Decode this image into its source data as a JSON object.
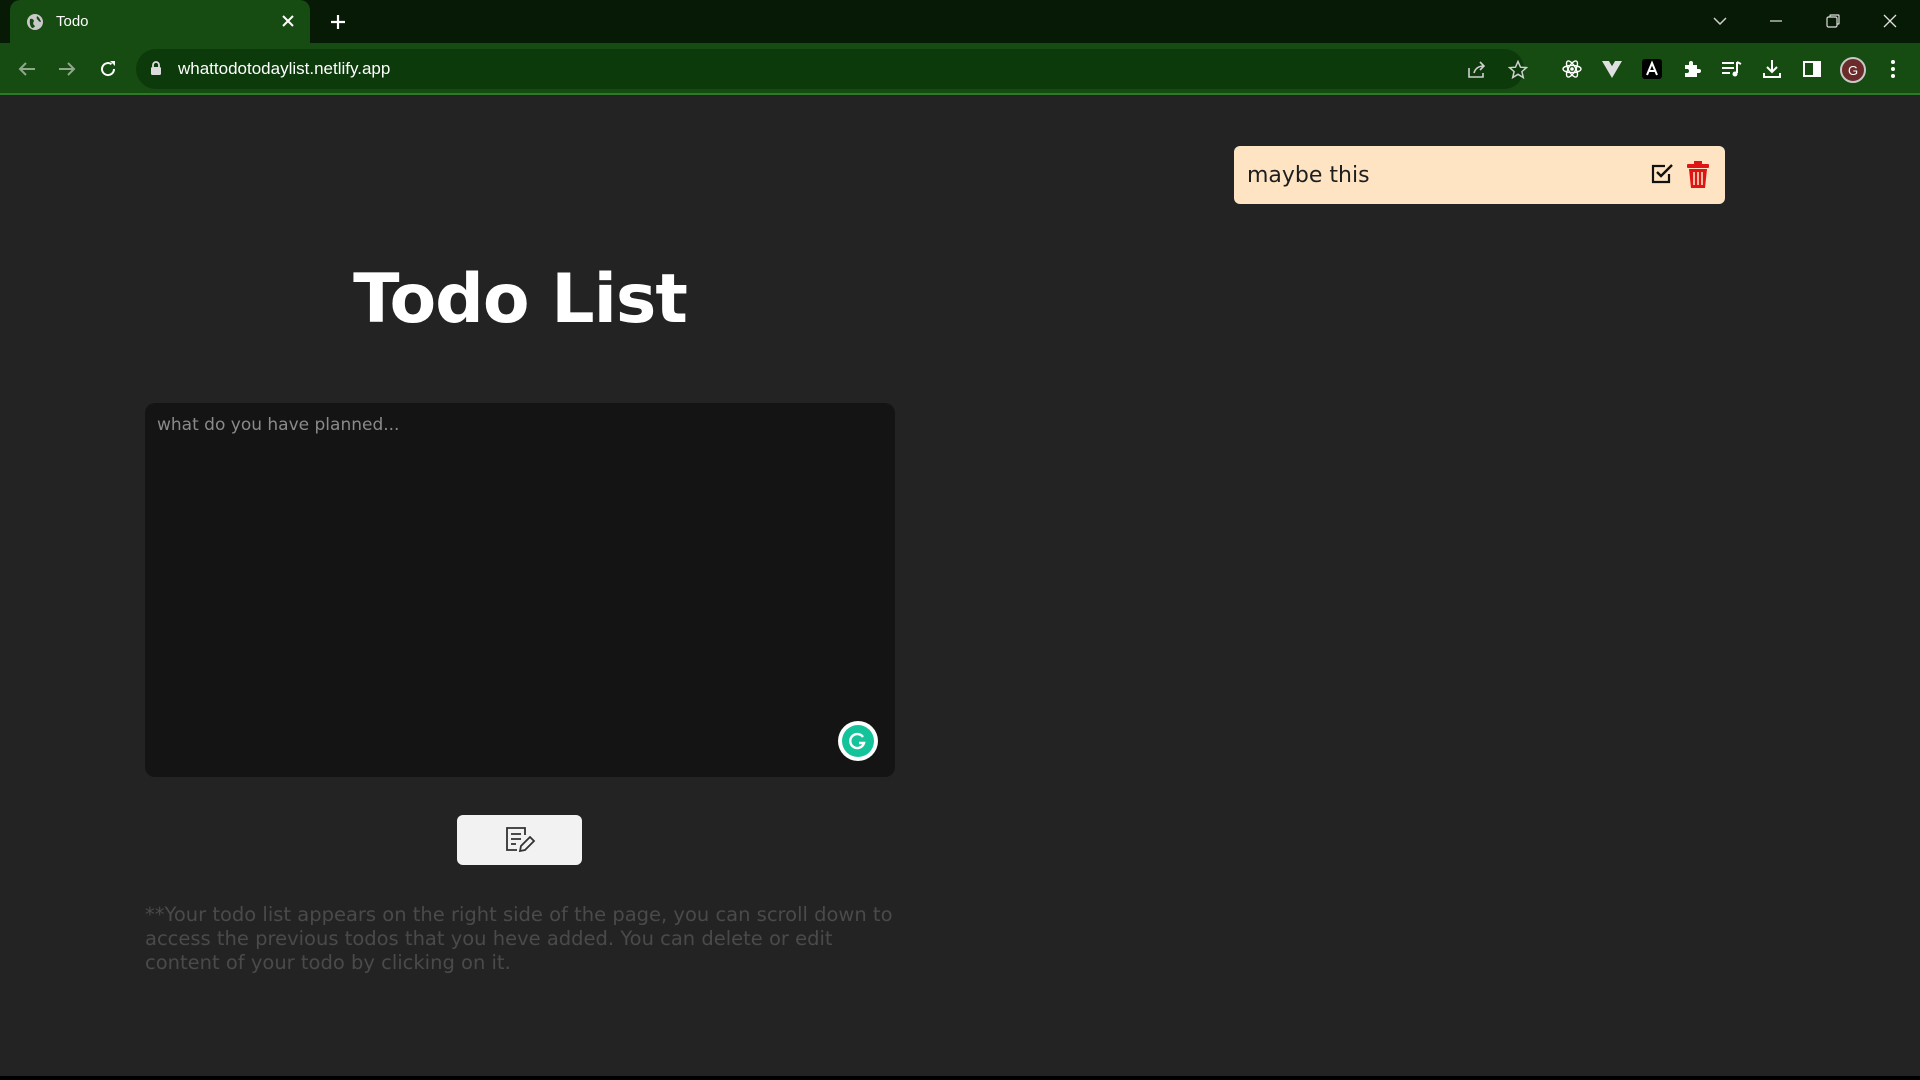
{
  "browser": {
    "tab_title": "Todo",
    "url": "whattodotodaylist.netlify.app",
    "avatar_letter": "G",
    "colors": {
      "frame": "#061a05",
      "tab": "#164b12",
      "omnibox": "#0d3a0b"
    }
  },
  "page": {
    "title": "Todo List",
    "input_placeholder": "what do you have planned...",
    "hint": "**Your todo list appears on the right side of the page, you can scroll down to access the previous todos that you heve added. You can delete or edit content of your todo by clicking on it.",
    "add_button_icon": "edit-note-icon"
  },
  "todos": [
    {
      "text": "maybe this",
      "actions": [
        "check-icon",
        "trash-icon"
      ]
    }
  ],
  "colors": {
    "page_bg": "#232323",
    "todo_bg": "#ffe4c4",
    "trash": "#e01414",
    "input_bg": "#141414"
  }
}
